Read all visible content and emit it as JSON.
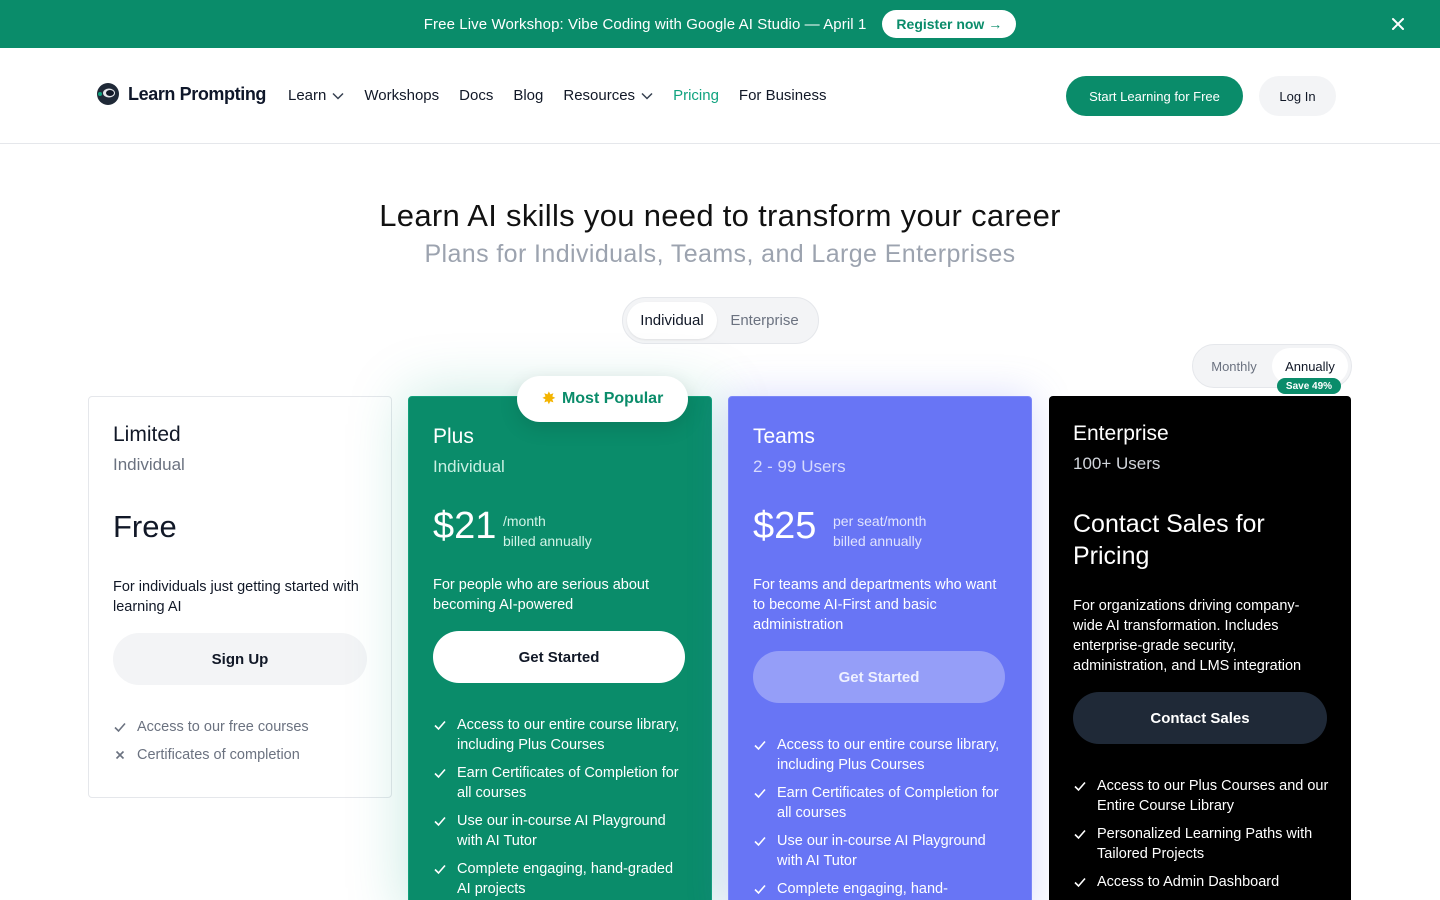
{
  "banner": {
    "text": "Free Live Workshop: Vibe Coding with Google AI Studio — April 1",
    "button_label": "Register now →"
  },
  "nav": {
    "logo_text": "Learn Prompting",
    "links": [
      {
        "label": "Learn",
        "dropdown": true
      },
      {
        "label": "Workshops"
      },
      {
        "label": "Docs"
      },
      {
        "label": "Blog"
      },
      {
        "label": "Resources",
        "dropdown": true
      },
      {
        "label": "Pricing",
        "active": true
      },
      {
        "label": "For Business"
      }
    ],
    "cta_label": "Start Learning for Free",
    "login_label": "Log In"
  },
  "hero": {
    "title": "Learn AI skills you need to transform your career",
    "subtitle": "Plans for Individuals, Teams, and Large Enterprises"
  },
  "audience_toggle": {
    "options": [
      "Individual",
      "Enterprise"
    ],
    "selected": "Individual"
  },
  "billing_toggle": {
    "options": [
      "Monthly",
      "Annually"
    ],
    "selected": "Annually",
    "badge": "Save 49%"
  },
  "popular_badge": "Most Popular",
  "plans": [
    {
      "name": "Limited",
      "audience": "Individual",
      "price": "Free",
      "description": "For individuals just getting started with learning AI",
      "button": "Sign Up",
      "features": [
        {
          "text": "Access to our free courses",
          "included": true
        },
        {
          "text": "Certificates of completion",
          "included": false
        }
      ]
    },
    {
      "name": "Plus",
      "audience": "Individual",
      "price": "$21",
      "price_unit": "/month",
      "price_note": "billed annually",
      "description": "For people who are serious about becoming AI-powered",
      "button": "Get Started",
      "features": [
        {
          "text": "Access to our entire course library, including Plus Courses",
          "included": true
        },
        {
          "text": "Earn Certificates of Completion for all courses",
          "included": true
        },
        {
          "text": "Use our in-course AI Playground with AI Tutor",
          "included": true
        },
        {
          "text": "Complete engaging, hand-graded AI projects",
          "included": true
        }
      ]
    },
    {
      "name": "Teams",
      "audience": "2 - 99 Users",
      "price": "$25",
      "price_unit": "per seat/month",
      "price_note": "billed annually",
      "description": "For teams and departments who want to become AI-First and basic administration",
      "button": "Get Started",
      "features": [
        {
          "text": "Access to our entire course library, including Plus Courses",
          "included": true
        },
        {
          "text": "Earn Certificates of Completion for all courses",
          "included": true
        },
        {
          "text": "Use our in-course AI Playground with AI Tutor",
          "included": true
        },
        {
          "text": "Complete engaging, hand-",
          "included": true
        }
      ]
    },
    {
      "name": "Enterprise",
      "audience": "100+ Users",
      "price": "Contact Sales for Pricing",
      "description": "For organizations driving company-wide AI transformation. Includes enterprise-grade security, administration, and LMS integration",
      "button": "Contact Sales",
      "features": [
        {
          "text": "Access to our Plus Courses and our Entire Course Library",
          "included": true
        },
        {
          "text": "Personalized Learning Paths with Tailored Projects",
          "included": true
        },
        {
          "text": "Access to Admin Dashboard",
          "included": true
        }
      ]
    }
  ],
  "colors": {
    "brand_green": "#0a8c6a",
    "teams_purple": "#6875f5",
    "enterprise_black": "#000000",
    "muted_gray": "#9ca3af"
  }
}
